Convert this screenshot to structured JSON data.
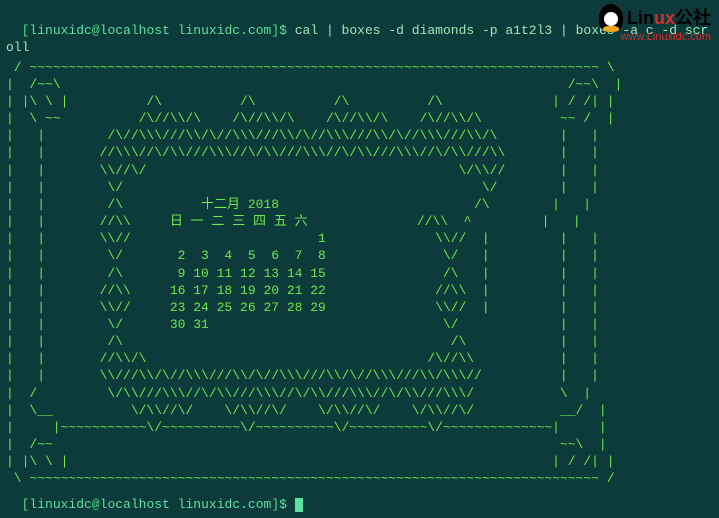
{
  "prompt1": {
    "user": "linuxidc",
    "host": "localhost",
    "path": "linuxidc.com",
    "symbol": "$",
    "command": "cal | boxes -d diamonds -p a1t2l3 | boxes -a c -d scroll"
  },
  "calendar": {
    "title": "十二月 2018",
    "headers": "日 一 二 三 四 五 六",
    "rows": [
      "                   1",
      " 2  3  4  5  6  7  8",
      " 9 10 11 12 13 14 15",
      "16 17 18 19 20 21 22",
      "23 24 25 26 27 28 29",
      "30 31"
    ]
  },
  "ascii_art": " / ~~~~~~~~~~~~~~~~~~~~~~~~~~~~~~~~~~~~~~~~~~~~~~~~~~~~~~~~~~~~~~~~~~~~~~~~~ \\\n|  /~~\\                                                                 /~~\\  |\n| |\\ \\ |          /\\          /\\          /\\          /\\              | / /| |\n|  \\ ~~          /\\//\\\\/\\    /\\//\\\\/\\    /\\//\\\\/\\    /\\//\\\\/\\          ~~ /  |\n|   |        /\\//\\\\\\///\\\\/\\//\\\\\\///\\\\/\\//\\\\\\///\\\\/\\//\\\\\\///\\\\/\\        |   |\n|   |       //\\\\\\//\\/\\\\///\\\\\\//\\/\\\\///\\\\\\//\\/\\\\///\\\\\\//\\/\\\\///\\\\       |   |\n|   |       \\\\//\\/                                        \\/\\\\//       |   |\n|   |        \\/                                              \\/        |   |\n|   |        /\\          十二月 2018                         /\\        |   |\n|   |       //\\\\     日 一 二 三 四 五 六              //\\\\  ^         |   |\n|   |       \\\\//                        1              \\\\//  |         |   |\n|   |        \\/       2  3  4  5  6  7  8               \\/   |         |   |\n|   |        /\\       9 10 11 12 13 14 15               /\\   |         |   |\n|   |       //\\\\     16 17 18 19 20 21 22              //\\\\  |         |   |\n|   |       \\\\//     23 24 25 26 27 28 29              \\\\//  |         |   |\n|   |        \\/      30 31                              \\/             |   |\n|   |        /\\                                          /\\            |   |\n|   |       //\\\\/\\                                    /\\//\\\\           |   |\n|   |       \\\\///\\\\/\\//\\\\\\///\\\\/\\//\\\\\\///\\\\/\\//\\\\\\///\\\\/\\\\\\//          |   |\n|  /         \\/\\\\///\\\\\\//\\/\\\\///\\\\\\//\\/\\\\///\\\\\\//\\/\\\\///\\\\\\/           \\  |\n|  \\__          \\/\\\\//\\/    \\/\\\\//\\/    \\/\\\\//\\/    \\/\\\\//\\/           __/  |\n|     |~~~~~~~~~~~\\/~~~~~~~~~~\\/~~~~~~~~~~\\/~~~~~~~~~~\\/~~~~~~~~~~~~~~|     |\n|  /~~                                                                 ~~\\  |\n| |\\ \\ |                                                              | / /| |\n \\ ~~~~~~~~~~~~~~~~~~~~~~~~~~~~~~~~~~~~~~~~~~~~~~~~~~~~~~~~~~~~~~~~~~~~~~~~~ /",
  "prompt2": {
    "user": "linuxidc",
    "host": "localhost",
    "path": "linuxidc.com",
    "symbol": "$"
  },
  "watermark": {
    "brand_lin": "Lin",
    "brand_ux": "ux",
    "brand_gs": "公社",
    "url": "www.Linuxidc.com"
  }
}
